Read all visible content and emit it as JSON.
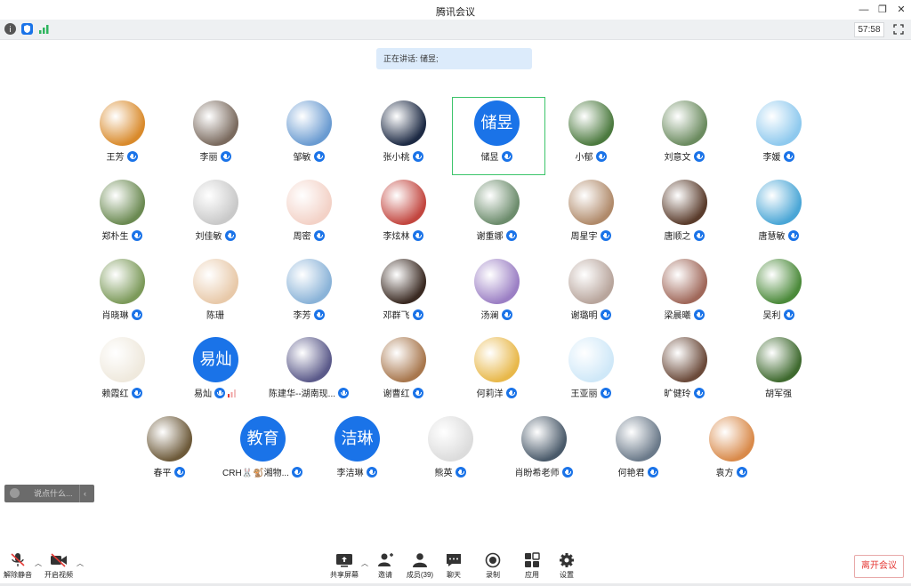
{
  "window": {
    "title": "腾讯会议"
  },
  "infobar": {
    "timer": "57:58"
  },
  "speaking": {
    "label": "正在讲话: 储昱;"
  },
  "participants": [
    {
      "name": "王芳"
    },
    {
      "name": "李丽"
    },
    {
      "name": "邹敏"
    },
    {
      "name": "张小桃"
    },
    {
      "name": "储昱",
      "avatar_text": "储昱"
    },
    {
      "name": "小郁"
    },
    {
      "name": "刘意文"
    },
    {
      "name": "李媛"
    },
    {
      "name": "郑朴生"
    },
    {
      "name": "刘佳敏"
    },
    {
      "name": "周密"
    },
    {
      "name": "李炫林"
    },
    {
      "name": "谢重娜"
    },
    {
      "name": "周星宇"
    },
    {
      "name": "唐顺之"
    },
    {
      "name": "唐慧敏"
    },
    {
      "name": "肖晓琳"
    },
    {
      "name": "陈珊"
    },
    {
      "name": "李芳"
    },
    {
      "name": "邓群飞"
    },
    {
      "name": "汤澜"
    },
    {
      "name": "谢璐明"
    },
    {
      "name": "梁晨曦"
    },
    {
      "name": "吴利"
    },
    {
      "name": "赖霞红"
    },
    {
      "name": "易灿",
      "avatar_text": "易灿"
    },
    {
      "name": "陈建华--湖南现..."
    },
    {
      "name": "谢曹红"
    },
    {
      "name": "何莉洋"
    },
    {
      "name": "王亚丽"
    },
    {
      "name": "旷健玲"
    },
    {
      "name": "胡军强"
    },
    {
      "name": "春平"
    },
    {
      "name": "CRH🐰🐒湘物..."
    },
    {
      "name": "李洁琳",
      "avatar_text": "洁琳"
    },
    {
      "name": "熊英"
    },
    {
      "name": "肖盼希老师"
    },
    {
      "name": "何艳君"
    },
    {
      "name": "袁方"
    }
  ],
  "extra_avatar_text": {
    "crh": "教育"
  },
  "chat": {
    "placeholder": "说点什么..."
  },
  "toolbar": {
    "mute": "解除静音",
    "video": "开启视频",
    "share": "共享屏幕",
    "invite": "邀请",
    "members": "成员(39)",
    "chat": "聊天",
    "record": "录制",
    "apps": "应用",
    "settings": "设置",
    "leave": "离开会议"
  },
  "colors": {
    "accent": "#1a73e8",
    "leave": "#e53935",
    "active_border": "#3cc46a"
  }
}
